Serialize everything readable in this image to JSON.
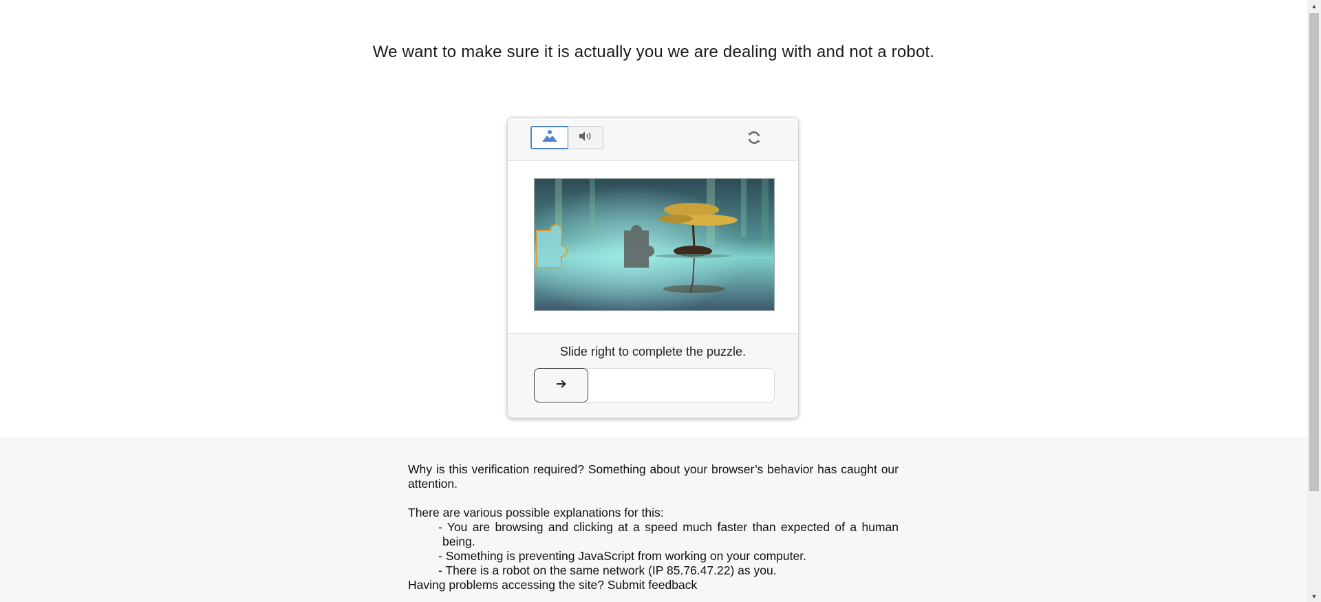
{
  "heading": "We want to make sure it is actually you we are dealing with and not a robot.",
  "captcha": {
    "modes": {
      "image_icon": "image-mode-icon",
      "audio_icon": "speaker-icon",
      "selected": "image"
    },
    "refresh_icon": "refresh-icon",
    "puzzle_image_description": "",
    "instruction": "Slide right to complete the puzzle.",
    "slider": {
      "handle_icon": "arrow-right-icon",
      "position": 0
    }
  },
  "info": {
    "why_text": "Why is this verification required? Something about your browser’s behavior has caught our attention.",
    "explanations_intro": "There are various possible explanations for this:",
    "reasons": [
      "- You are browsing and clicking at a speed much faster than expected of a human being.",
      "- Something is preventing JavaScript from working on your computer.",
      "- There is a robot on the same network (IP 85.76.47.22) as you."
    ],
    "feedback_prefix": "Having problems accessing the site? ",
    "feedback_link": "Submit feedback"
  },
  "colors": {
    "accent": "#4a86c8",
    "panel_bg": "#f7f7f7",
    "text": "#111111"
  }
}
